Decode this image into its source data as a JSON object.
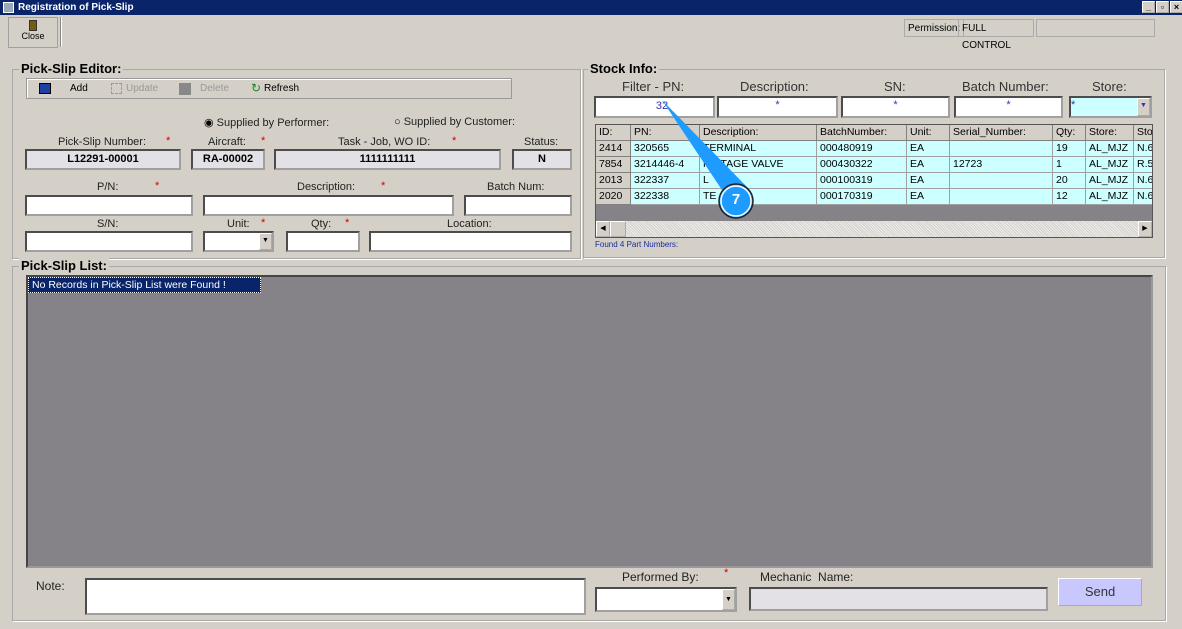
{
  "window": {
    "title": "Registration of Pick-Slip"
  },
  "toolbar": {
    "close_label": "Close",
    "permission_label": "Permission:",
    "permission_value": "FULL CONTROL"
  },
  "editor": {
    "title": "Pick-Slip Editor:",
    "actions": {
      "add": "Add",
      "update": "Update",
      "delete": "Delete",
      "refresh": "Refresh"
    },
    "supplied_by_performer": "Supplied by Performer:",
    "supplied_by_customer": "Supplied by Customer:",
    "supplied_selected": "performer",
    "labels": {
      "pick_slip_number": "Pick-Slip Number:",
      "aircraft": "Aircraft:",
      "task": "Task - Job, WO ID:",
      "status": "Status:",
      "pn": "P/N:",
      "description": "Description:",
      "batch_num": "Batch Num:",
      "sn": "S/N:",
      "unit": "Unit:",
      "qty": "Qty:",
      "location": "Location:"
    },
    "required_mark": "*",
    "values": {
      "pick_slip_number": "L12291-00001",
      "aircraft": "RA-00002",
      "task": "1111111111",
      "status": "N"
    }
  },
  "stock": {
    "title": "Stock Info:",
    "filters": {
      "pn_label": "Filter - PN:",
      "pn_value": "32",
      "description_label": "Description:",
      "description_value": "*",
      "sn_label": "SN:",
      "sn_value": "*",
      "batch_label": "Batch Number:",
      "batch_value": "*",
      "store_label": "Store:",
      "store_value": "*"
    },
    "columns": [
      "ID:",
      "PN:",
      "Description:",
      "BatchNumber:",
      "Unit:",
      "Serial_Number:",
      "Qty:",
      "Store:",
      "Sto"
    ],
    "rows": [
      [
        "2414",
        "320565",
        "TERMINAL",
        "000480919",
        "EA",
        "",
        "19",
        "AL_MJZ",
        "N.6"
      ],
      [
        "7854",
        "3214446-4",
        "H STAGE VALVE",
        "000430322",
        "EA",
        "12723",
        "1",
        "AL_MJZ",
        "R.5"
      ],
      [
        "2013",
        "322337",
        "L",
        "000100319",
        "EA",
        "",
        "20",
        "AL_MJZ",
        "N.6"
      ],
      [
        "2020",
        "322338",
        "TE",
        "000170319",
        "EA",
        "",
        "12",
        "AL_MJZ",
        "N.6"
      ]
    ],
    "found_text": "Found 4 Part Numbers:"
  },
  "list": {
    "title": "Pick-Slip List:",
    "empty_message": "No Records in Pick-Slip List were Found !"
  },
  "footer": {
    "note_label": "Note:",
    "performed_by_label": "Performed By:",
    "mechanic_name_label": "Mechanic  Name:",
    "send_label": "Send"
  },
  "callout": {
    "number": "7",
    "color": "#1e9bff"
  }
}
